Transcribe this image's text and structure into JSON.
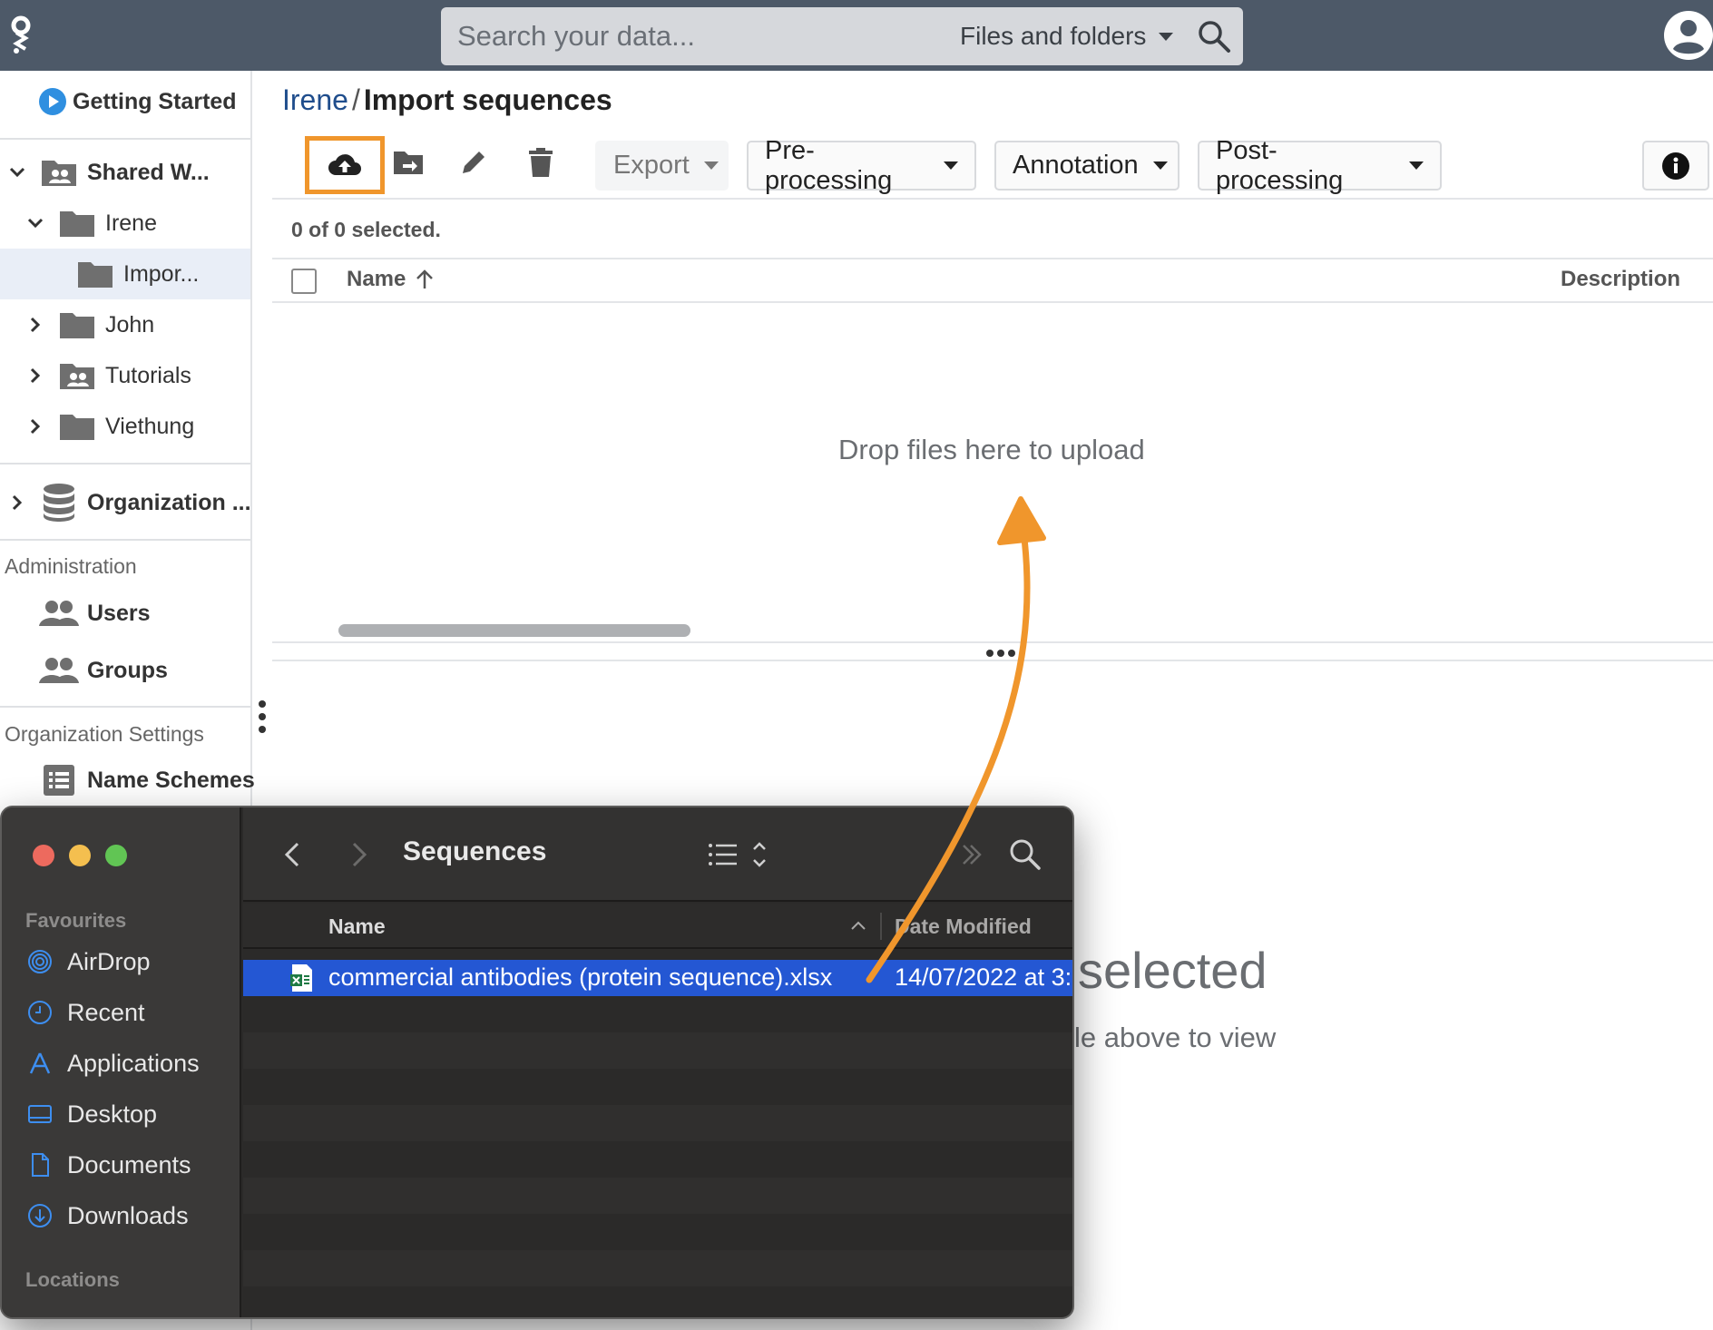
{
  "topbar": {
    "search_placeholder": "Search your data...",
    "search_scope": "Files and folders"
  },
  "sidebar": {
    "getting_started": "Getting Started",
    "shared_workspace": "Shared W...",
    "tree": [
      {
        "label": "Irene",
        "expanded": true
      },
      {
        "label": "Impor...",
        "selected": true
      },
      {
        "label": "John",
        "expanded": false
      },
      {
        "label": "Tutorials",
        "expanded": false
      },
      {
        "label": "Viethung",
        "expanded": false
      }
    ],
    "organization": "Organization ...",
    "admin_section": "Administration",
    "admin_items": [
      "Users",
      "Groups"
    ],
    "org_settings_section": "Organization Settings",
    "org_settings_items": [
      "Name Schemes"
    ]
  },
  "breadcrumb": {
    "parent": "Irene",
    "separator": "/",
    "current": "Import sequences"
  },
  "toolbar": {
    "export": "Export",
    "preprocessing": "Pre-processing",
    "annotation": "Annotation",
    "postprocessing": "Post-processing"
  },
  "table": {
    "selected_count": "0 of 0 selected.",
    "columns": [
      "Name",
      "Description"
    ],
    "dropzone": "Drop files here to upload"
  },
  "detail": {
    "title_fragment": "selected",
    "hint_fragment": "le above to view"
  },
  "finder": {
    "title": "Sequences",
    "favourites_label": "Favourites",
    "favourites": [
      "AirDrop",
      "Recent",
      "Applications",
      "Desktop",
      "Documents",
      "Downloads"
    ],
    "locations_label": "Locations",
    "columns": {
      "name": "Name",
      "date": "Date Modified"
    },
    "files": [
      {
        "name": "commercial antibodies (protein sequence).xlsx",
        "date": "14/07/2022 at 3:"
      }
    ]
  },
  "colors": {
    "topbar": "#4d5968",
    "highlight": "#f0962c",
    "link": "#1f4d8c",
    "finder_selection": "#2457d3"
  }
}
